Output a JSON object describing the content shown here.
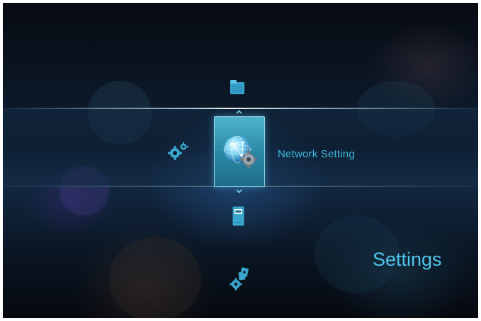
{
  "menu": {
    "selected_label": "Network Setting",
    "section_title": "Settings"
  },
  "icons": {
    "above": "folder-icon",
    "left": "gears-icon",
    "selected": "network-globe-gear-icon",
    "below": "wd-drive-icon",
    "bottom": "media-gears-icon"
  },
  "colors": {
    "accent": "#3fb8e0",
    "tile": "#2a8aa8",
    "background": "#0d1a2b"
  }
}
